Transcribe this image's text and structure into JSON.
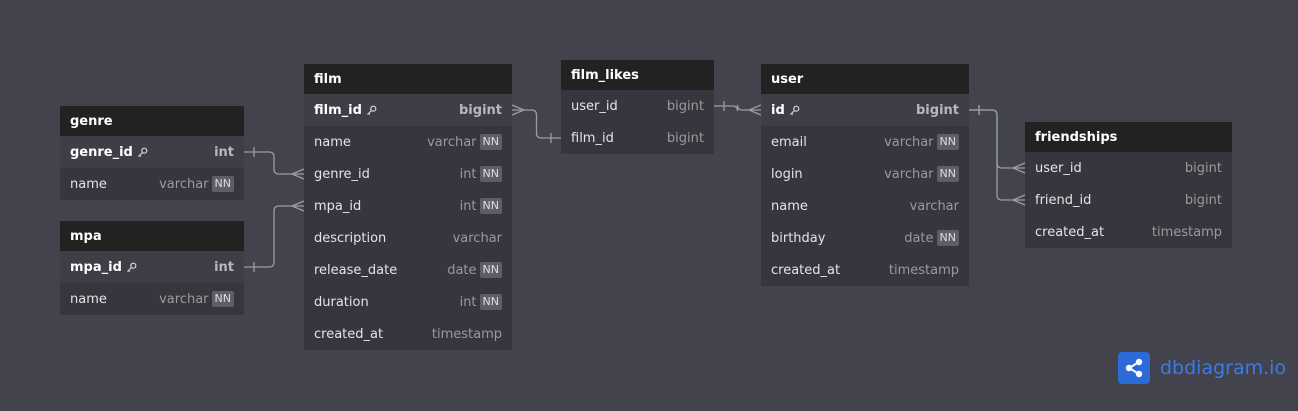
{
  "tables": [
    {
      "id": "genre",
      "name": "genre",
      "columns": [
        {
          "name": "genre_id",
          "type": "int",
          "pk": true,
          "nn": false
        },
        {
          "name": "name",
          "type": "varchar",
          "pk": false,
          "nn": true
        }
      ]
    },
    {
      "id": "mpa",
      "name": "mpa",
      "columns": [
        {
          "name": "mpa_id",
          "type": "int",
          "pk": true,
          "nn": false
        },
        {
          "name": "name",
          "type": "varchar",
          "pk": false,
          "nn": true
        }
      ]
    },
    {
      "id": "film",
      "name": "film",
      "columns": [
        {
          "name": "film_id",
          "type": "bigint",
          "pk": true,
          "nn": false
        },
        {
          "name": "name",
          "type": "varchar",
          "pk": false,
          "nn": true
        },
        {
          "name": "genre_id",
          "type": "int",
          "pk": false,
          "nn": true
        },
        {
          "name": "mpa_id",
          "type": "int",
          "pk": false,
          "nn": true
        },
        {
          "name": "description",
          "type": "varchar",
          "pk": false,
          "nn": false
        },
        {
          "name": "release_date",
          "type": "date",
          "pk": false,
          "nn": true
        },
        {
          "name": "duration",
          "type": "int",
          "pk": false,
          "nn": true
        },
        {
          "name": "created_at",
          "type": "timestamp",
          "pk": false,
          "nn": false
        }
      ]
    },
    {
      "id": "film_likes",
      "name": "film_likes",
      "columns": [
        {
          "name": "user_id",
          "type": "bigint",
          "pk": false,
          "nn": false
        },
        {
          "name": "film_id",
          "type": "bigint",
          "pk": false,
          "nn": false
        }
      ]
    },
    {
      "id": "user",
      "name": "user",
      "columns": [
        {
          "name": "id",
          "type": "bigint",
          "pk": true,
          "nn": false
        },
        {
          "name": "email",
          "type": "varchar",
          "pk": false,
          "nn": true
        },
        {
          "name": "login",
          "type": "varchar",
          "pk": false,
          "nn": true
        },
        {
          "name": "name",
          "type": "varchar",
          "pk": false,
          "nn": false
        },
        {
          "name": "birthday",
          "type": "date",
          "pk": false,
          "nn": true
        },
        {
          "name": "created_at",
          "type": "timestamp",
          "pk": false,
          "nn": false
        }
      ]
    },
    {
      "id": "friendships",
      "name": "friendships",
      "columns": [
        {
          "name": "user_id",
          "type": "bigint",
          "pk": false,
          "nn": false
        },
        {
          "name": "friend_id",
          "type": "bigint",
          "pk": false,
          "nn": false
        },
        {
          "name": "created_at",
          "type": "timestamp",
          "pk": false,
          "nn": false
        }
      ]
    }
  ],
  "labels": {
    "nn_badge": "NN"
  },
  "relationships": [
    {
      "from": "genre.genre_id",
      "to": "film.genre_id",
      "from_card": "one",
      "to_card": "many"
    },
    {
      "from": "mpa.mpa_id",
      "to": "film.mpa_id",
      "from_card": "one",
      "to_card": "many"
    },
    {
      "from": "film.film_id",
      "to": "film_likes.film_id",
      "from_card": "many",
      "to_card": "one"
    },
    {
      "from": "film_likes.user_id",
      "to": "user.id",
      "from_card": "one",
      "to_card": "many"
    },
    {
      "from": "user.id",
      "to": "friendships.user_id",
      "from_card": "one",
      "to_card": "many"
    },
    {
      "from": "user.id",
      "to": "friendships.friend_id",
      "from_card": "one",
      "to_card": "many"
    }
  ],
  "brand": {
    "name": "dbdiagram.io"
  },
  "colors": {
    "background": "#42434c",
    "table_header": "#222222",
    "table_body": "#36373e",
    "connector": "#9a9ba4",
    "brand": "#2c6bd8"
  }
}
